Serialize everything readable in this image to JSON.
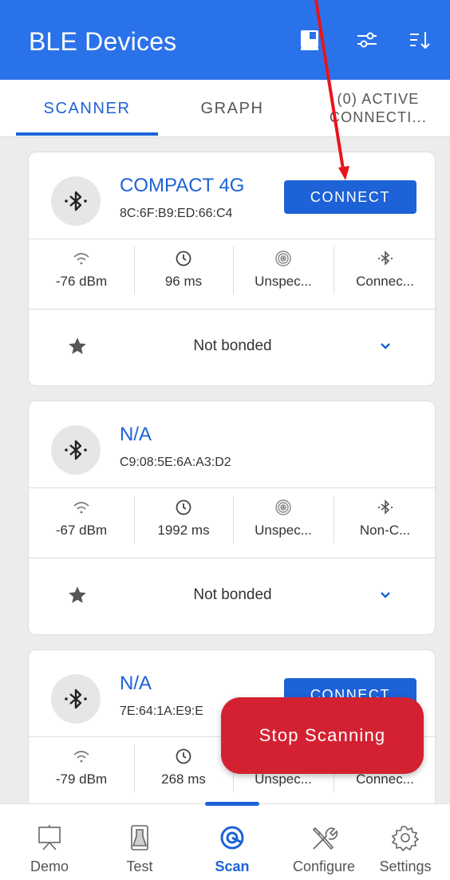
{
  "appbar": {
    "title": "BLE Devices",
    "actions": [
      "book-icon",
      "filter-sliders-icon",
      "sort-icon"
    ]
  },
  "tabs": [
    {
      "label": "SCANNER",
      "active": true
    },
    {
      "label": "GRAPH",
      "active": false
    },
    {
      "label_line1": "(0) ACTIVE",
      "label_line2": "CONNECTI...",
      "active": false
    }
  ],
  "devices": [
    {
      "name": "COMPACT 4G",
      "address": "8C:6F:B9:ED:66:C4",
      "connect_label": "CONNECT",
      "rssi": "-76 dBm",
      "interval": "96 ms",
      "beacon": "Unspec...",
      "connectability": "Connec...",
      "bond": "Not bonded"
    },
    {
      "name": "N/A",
      "address": "C9:08:5E:6A:A3:D2",
      "connect_label": "",
      "rssi": "-67 dBm",
      "interval": "1992 ms",
      "beacon": "Unspec...",
      "connectability": "Non-C...",
      "bond": "Not bonded"
    },
    {
      "name": "N/A",
      "address": "7E:64:1A:E9:E",
      "connect_label": "CONNECT",
      "rssi": "-79 dBm",
      "interval": "268 ms",
      "beacon": "Unspec...",
      "connectability": "Connec..."
    }
  ],
  "fab": {
    "label": "Stop Scanning"
  },
  "bottom_nav": [
    {
      "label": "Demo",
      "icon": "monitor-easel-icon",
      "active": false
    },
    {
      "label": "Test",
      "icon": "flask-icon",
      "active": false
    },
    {
      "label": "Scan",
      "icon": "scan-target-icon",
      "active": true
    },
    {
      "label": "Configure",
      "icon": "tools-icon",
      "active": false
    },
    {
      "label": "Settings",
      "icon": "gear-icon",
      "active": false
    }
  ],
  "colors": {
    "primary": "#2a72ea",
    "accent": "#1d62d6",
    "fab": "#d32132",
    "annotation_arrow": "#e8141b"
  }
}
